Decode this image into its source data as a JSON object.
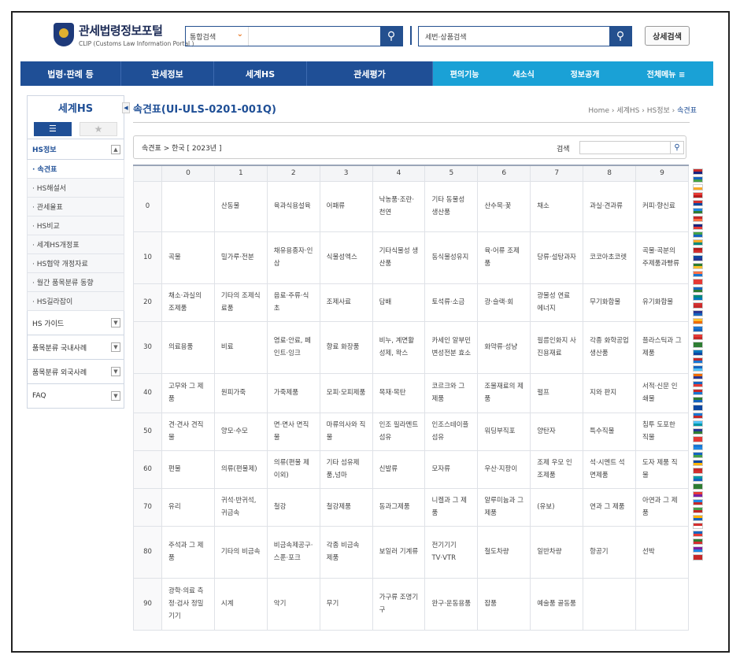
{
  "header": {
    "logo_title": "관세법령정보포털",
    "logo_sub": "CLIP (Customs Law Information Portal )",
    "search_select": "통합검색",
    "search2_placeholder": "세번·상품검색",
    "adv_search": "상세검색"
  },
  "nav": {
    "main": [
      "법령·판례 등",
      "관세정보",
      "세계HS",
      "관세평가"
    ],
    "sub": [
      "편의기능",
      "새소식",
      "정보공개",
      "전체메뉴 ≡"
    ]
  },
  "sidebar": {
    "title": "세계HS",
    "section": "HS정보",
    "items": [
      "· 속견표",
      "· HS해설서",
      "· 관세율표",
      "· HS비교",
      "· 세계HS개정표",
      "· HS협약 개정자료",
      "· 월간 품목분류 동향",
      "· HS길라잡이"
    ],
    "categories": [
      "HS 가이드",
      "품목분류 국내사례",
      "품목분류 외국사례",
      "FAQ"
    ]
  },
  "content": {
    "title": "속견표(UI-ULS-0201-001Q)",
    "breadcrumb": [
      "Home",
      "세계HS",
      "HS정보",
      "속견표"
    ],
    "breadcrumb_sep": "›",
    "info": "속견표 > 한국 [ 2023년 ]",
    "search_label": "검색"
  },
  "table": {
    "headers": [
      "",
      "0",
      "1",
      "2",
      "3",
      "4",
      "5",
      "6",
      "7",
      "8",
      "9"
    ],
    "rows": [
      {
        "h": "0",
        "c": [
          "",
          "산동물",
          "육과식용설육",
          "어패류",
          "낙농품·조란·천연",
          "기타 동물성 생산품",
          "산수목·꽃",
          "채소",
          "과실·견과류",
          "커피·향신료"
        ]
      },
      {
        "h": "10",
        "c": [
          "곡물",
          "밀가루·전분",
          "채유용종자·인삼",
          "식물성엑스",
          "기타식물성 생산품",
          "동식물성유지",
          "육·어류 조제품",
          "당류·설탕과자",
          "코코아초코렛",
          "곡물·곡분의 주제품과빵류"
        ]
      },
      {
        "h": "20",
        "c": [
          "채소·과실의 조제품",
          "기타의 조제식료품",
          "음료·주류·식초",
          "조제사료",
          "담배",
          "토석류·소금",
          "광·슬랙·회",
          "광물성 연료 에너지",
          "무기화합물",
          "유기화합물"
        ]
      },
      {
        "h": "30",
        "c": [
          "의료용품",
          "비료",
          "염료·안료, 페인트·잉크",
          "향료 화장품",
          "비누, 계면활성제, 왁스",
          "카세인 알부민 변성전분 효소",
          "화약류·성냥",
          "필름인화지 사진용재료",
          "각종 화학공업 생산품",
          "플라스틱과 그제품"
        ]
      },
      {
        "h": "40",
        "c": [
          "고무와 그 제품",
          "원피가죽",
          "가죽제품",
          "모피·모피제품",
          "목재·목탄",
          "코르크와 그 제품",
          "조물재료의 제품",
          "펄프",
          "지와 판지",
          "서적·신문 인쇄물"
        ]
      },
      {
        "h": "50",
        "c": [
          "견·견사 견직물",
          "양모·수모",
          "면·면사 면직물",
          "마류의사와 직물",
          "인조 필라멘트 섬유",
          "인조스테이플 섬유",
          "워딩부직포",
          "양탄자",
          "특수직물",
          "침투 도포한 직물"
        ]
      },
      {
        "h": "60",
        "c": [
          "편물",
          "의류(편물제)",
          "의류(편물 제이외)",
          "기타 섬유제품,넝마",
          "신발류",
          "모자류",
          "우산·지팡이",
          "조제 우모 인조제품",
          "석·시멘트 석면제품",
          "도자 제품 직물"
        ]
      },
      {
        "h": "70",
        "c": [
          "유리",
          "귀석·반귀석,귀금속",
          "철강",
          "철강제품",
          "동과그제품",
          "니켈과 그 제품",
          "알루미늄과 그 제품",
          "(유보)",
          "연과 그 제품",
          "아연과 그 제품"
        ]
      },
      {
        "h": "80",
        "c": [
          "주석과 그 제품",
          "기타의 비금속",
          "비금속제공구·스푼·포크",
          "각종 비금속 제품",
          "보일러 기계류",
          "전기기기 TV·VTR",
          "철도차량",
          "일반차량",
          "항공기",
          "선박"
        ]
      },
      {
        "h": "90",
        "c": [
          "광학·의료 측정·검사 정밀기기",
          "시계",
          "악기",
          "무기",
          "가구류 조명기구",
          "완구·운동용품",
          "잡품",
          "예술품 골동품",
          "",
          ""
        ]
      }
    ]
  },
  "flags": [
    "#c62828",
    "#1565c0",
    "#ffffff",
    "#e53935",
    "#d32f2f",
    "#1e88e5",
    "#c62828",
    "#1a237e",
    "#43a047",
    "#f9a825",
    "#b71c1c",
    "#0d47a1",
    "#2e7d32",
    "#ff7043",
    "#e53935",
    "#1565c0",
    "#00897b",
    "#d32f2f",
    "#283593",
    "#fbc02d",
    "#1976d2",
    "#e53935",
    "#2e7d32",
    "#0277bd",
    "#c62828",
    "#1565c0",
    "#ef6c00",
    "#1565c0",
    "#c62828",
    "#2e7d32",
    "#0d47a1",
    "#1976d2",
    "#4fc3f7",
    "#283593",
    "#e53935",
    "#1976d2",
    "#1565c0",
    "#0d47a1",
    "#c62828",
    "#0097a7",
    "#2e7d32",
    "#e53935",
    "#1e88e5",
    "#43a047",
    "#ffb300",
    "#d32f2f",
    "#1565c0",
    "#2e7d32",
    "#7b1fa2",
    "#c62828"
  ]
}
